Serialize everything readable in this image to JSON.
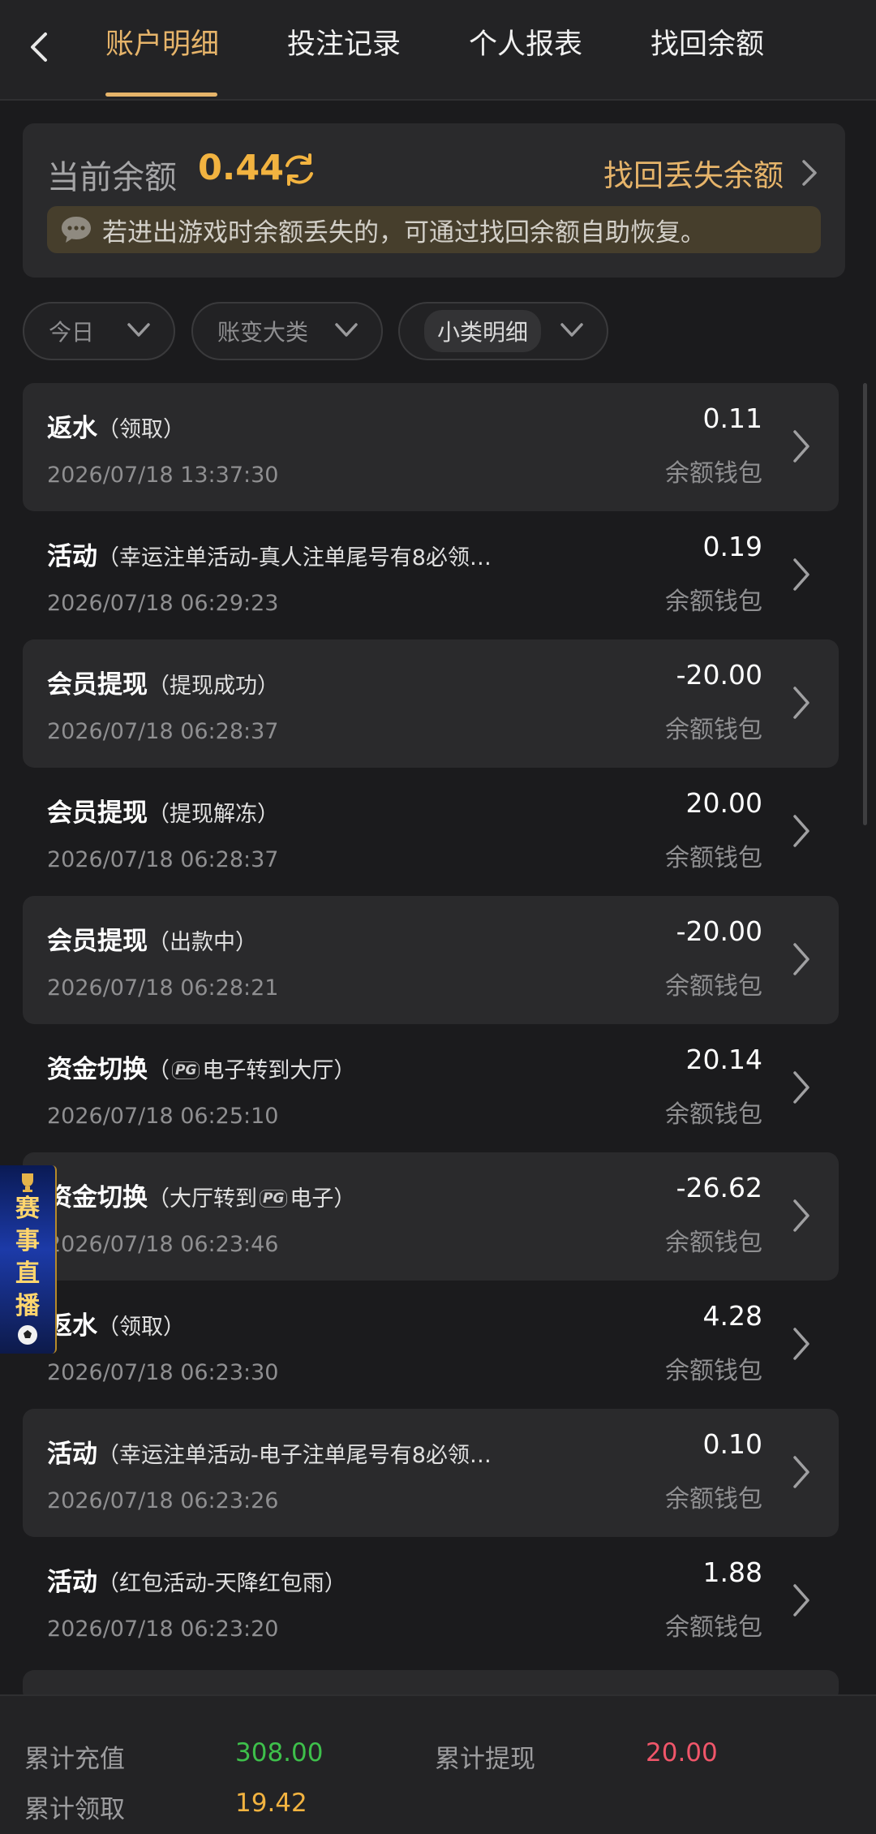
{
  "header": {
    "tabs": [
      {
        "label": "账户明细"
      },
      {
        "label": "投注记录"
      },
      {
        "label": "个人报表"
      },
      {
        "label": "找回余额"
      }
    ]
  },
  "balance": {
    "label": "当前余额",
    "value": "0.44",
    "recover_label": "找回丢失余额",
    "notice": "若进出游戏时余额丢失的，可通过找回余额自助恢复。"
  },
  "filters": [
    {
      "label": "今日"
    },
    {
      "label": "账变大类"
    },
    {
      "label": "小类明细"
    }
  ],
  "transactions": [
    {
      "title": "返水",
      "detail": "（领取）",
      "time": "2026/07/18 13:37:30",
      "amount": "0.11",
      "wallet": "余额钱包"
    },
    {
      "title": "活动",
      "detail": "（幸运注单活动-真人注单尾号有8必领…",
      "time": "2026/07/18 06:29:23",
      "amount": "0.19",
      "wallet": "余额钱包"
    },
    {
      "title": "会员提现",
      "detail": "（提现成功）",
      "time": "2026/07/18 06:28:37",
      "amount": "-20.00",
      "wallet": "余额钱包"
    },
    {
      "title": "会员提现",
      "detail": "（提现解冻）",
      "time": "2026/07/18 06:28:37",
      "amount": "20.00",
      "wallet": "余额钱包"
    },
    {
      "title": "会员提现",
      "detail": "（出款中）",
      "time": "2026/07/18 06:28:21",
      "amount": "-20.00",
      "wallet": "余额钱包"
    },
    {
      "title": "资金切换",
      "detail_pre": "（",
      "detail_logo": "PG",
      "detail_post": "电子转到大厅）",
      "time": "2026/07/18 06:25:10",
      "amount": "20.14",
      "wallet": "余额钱包"
    },
    {
      "title": "资金切换",
      "detail_pre": "（大厅转到",
      "detail_logo": "PG",
      "detail_post": "电子）",
      "time": "2026/07/18 06:23:46",
      "amount": "-26.62",
      "wallet": "余额钱包"
    },
    {
      "title": "返水",
      "detail": "（领取）",
      "time": "2026/07/18 06:23:30",
      "amount": "4.28",
      "wallet": "余额钱包"
    },
    {
      "title": "活动",
      "detail": "（幸运注单活动-电子注单尾号有8必领…",
      "time": "2026/07/18 06:23:26",
      "amount": "0.10",
      "wallet": "余额钱包"
    },
    {
      "title": "活动",
      "detail": "（红包活动-天降红包雨）",
      "time": "2026/07/18 06:23:20",
      "amount": "1.88",
      "wallet": "余额钱包"
    }
  ],
  "live_banner": {
    "chars": [
      "赛",
      "事",
      "直",
      "播"
    ]
  },
  "footer": {
    "recharge_label": "累计充值",
    "recharge_value": "308.00",
    "withdraw_label": "累计提现",
    "withdraw_value": "20.00",
    "claim_label": "累计领取",
    "claim_value": "19.42"
  },
  "colors": {
    "accent": "#e6b46a",
    "balance": "#f2b340",
    "positive": "#3ec04b",
    "negative": "#f0566a",
    "claim": "#f2b340"
  }
}
